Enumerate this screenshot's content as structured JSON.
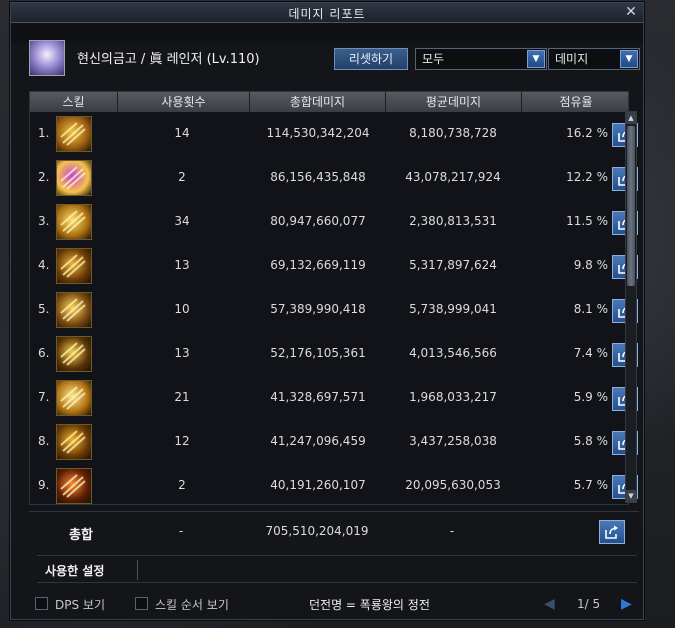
{
  "window": {
    "title": "데미지 리포트",
    "close": "✕"
  },
  "header": {
    "character": "현신의금고 / 眞 레인저 (Lv.110)",
    "reset_label": "리셋하기",
    "filter_target": "모두",
    "filter_sort": "데미지"
  },
  "columns": [
    "스킬",
    "사용횟수",
    "총합데미지",
    "평균데미지",
    "점유율"
  ],
  "rows": [
    {
      "rank": "1.",
      "count": "14",
      "total": "114,530,342,204",
      "avg": "8,180,738,728",
      "share": "16.2 %",
      "icon": "skill-icon-1"
    },
    {
      "rank": "2.",
      "count": "2",
      "total": "86,156,435,848",
      "avg": "43,078,217,924",
      "share": "12.2 %",
      "icon": "skill-icon-2"
    },
    {
      "rank": "3.",
      "count": "34",
      "total": "80,947,660,077",
      "avg": "2,380,813,531",
      "share": "11.5 %",
      "icon": "skill-icon-3"
    },
    {
      "rank": "4.",
      "count": "13",
      "total": "69,132,669,119",
      "avg": "5,317,897,624",
      "share": "9.8 %",
      "icon": "skill-icon-4"
    },
    {
      "rank": "5.",
      "count": "10",
      "total": "57,389,990,418",
      "avg": "5,738,999,041",
      "share": "8.1 %",
      "icon": "skill-icon-5"
    },
    {
      "rank": "6.",
      "count": "13",
      "total": "52,176,105,361",
      "avg": "4,013,546,566",
      "share": "7.4 %",
      "icon": "skill-icon-6"
    },
    {
      "rank": "7.",
      "count": "21",
      "total": "41,328,697,571",
      "avg": "1,968,033,217",
      "share": "5.9 %",
      "icon": "skill-icon-7"
    },
    {
      "rank": "8.",
      "count": "12",
      "total": "41,247,096,459",
      "avg": "3,437,258,038",
      "share": "5.8 %",
      "icon": "skill-icon-8"
    },
    {
      "rank": "9.",
      "count": "2",
      "total": "40,191,260,107",
      "avg": "20,095,630,053",
      "share": "5.7 %",
      "icon": "skill-icon-9"
    }
  ],
  "total": {
    "label": "총합",
    "count": "-",
    "total": "705,510,204,019",
    "avg": "-"
  },
  "settings_tab": "사용한 설정",
  "bottom": {
    "dps_label": "DPS 보기",
    "skill_order_label": "스킬 순서 보기",
    "dungeon": "던전명 = 폭룡왕의 정전",
    "page": "1/ 5"
  },
  "colors": {
    "accent": "#2f78d6",
    "header_bg": "#4a4e55",
    "gold": "#f2b824"
  }
}
